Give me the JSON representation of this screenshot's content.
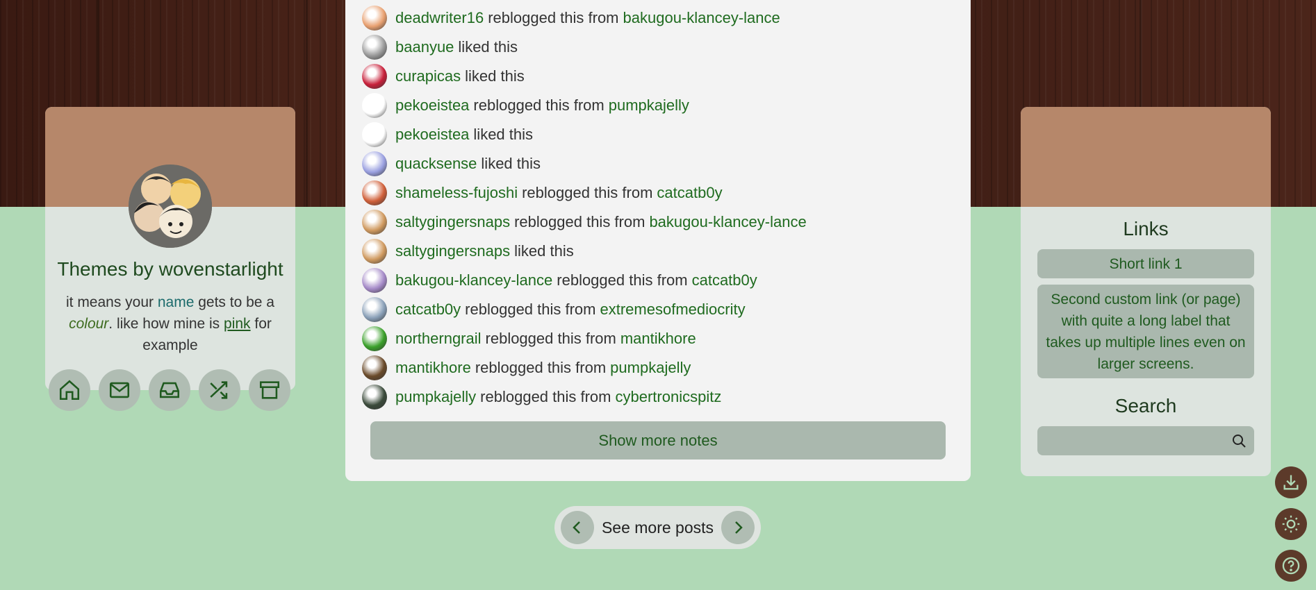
{
  "colors": {
    "accent_green": "#1f6b1f",
    "background_green": "#b0d9b6",
    "header_brown": "#b6876a",
    "wood_dark": "#3a1a12",
    "float_button": "#5c3a2a"
  },
  "sidebar_left": {
    "title": "Themes by wovenstarlight",
    "desc_1": "it means your ",
    "desc_name": "name",
    "desc_2": " gets to be a ",
    "desc_colour": "colour",
    "desc_3": ". like how mine is ",
    "desc_pink": "pink",
    "desc_4": " for example",
    "nav": [
      {
        "icon": "home-icon"
      },
      {
        "icon": "mail-icon"
      },
      {
        "icon": "inbox-icon"
      },
      {
        "icon": "shuffle-icon"
      },
      {
        "icon": "archive-icon"
      }
    ]
  },
  "notes": [
    {
      "user": "deadwriter16",
      "action": "reblogged this from",
      "from": "bakugou-klancey-lance",
      "avatar_color": "#e8a070"
    },
    {
      "user": "baanyue",
      "action": "liked this",
      "from": "",
      "avatar_color": "#9a9a9a"
    },
    {
      "user": "curapicas",
      "action": "liked this",
      "from": "",
      "avatar_color": "#c8203a"
    },
    {
      "user": "pekoeistea",
      "action": "reblogged this from",
      "from": "pumpkajelly",
      "avatar_color": "#ffffff"
    },
    {
      "user": "pekoeistea",
      "action": "liked this",
      "from": "",
      "avatar_color": "#ffffff"
    },
    {
      "user": "quacksense",
      "action": "liked this",
      "from": "",
      "avatar_color": "#9aa0e0"
    },
    {
      "user": "shameless-fujoshi",
      "action": "reblogged this from",
      "from": "catcatb0y",
      "avatar_color": "#d0603a"
    },
    {
      "user": "saltygingersnaps",
      "action": "reblogged this from",
      "from": "bakugou-klancey-lance",
      "avatar_color": "#d09a60"
    },
    {
      "user": "saltygingersnaps",
      "action": "liked this",
      "from": "",
      "avatar_color": "#d09a60"
    },
    {
      "user": "bakugou-klancey-lance",
      "action": "reblogged this from",
      "from": "catcatb0y",
      "avatar_color": "#a58ac8"
    },
    {
      "user": "catcatb0y",
      "action": "reblogged this from",
      "from": "extremesofmediocrity",
      "avatar_color": "#8aa0b8"
    },
    {
      "user": "northerngrail",
      "action": "reblogged this from",
      "from": "mantikhore",
      "avatar_color": "#3aa02a"
    },
    {
      "user": "mantikhore",
      "action": "reblogged this from",
      "from": "pumpkajelly",
      "avatar_color": "#6a4a2a"
    },
    {
      "user": "pumpkajelly",
      "action": "reblogged this from",
      "from": "cybertronicspitz",
      "avatar_color": "#3a4a3a"
    }
  ],
  "show_more_label": "Show more notes",
  "pagination": {
    "label": "See more posts",
    "prev_icon": "chevron-left-icon",
    "next_icon": "chevron-right-icon"
  },
  "sidebar_right": {
    "links_title": "Links",
    "link_1": "Short link 1",
    "link_2": "Second custom link (or page) with quite a long label that takes up multiple lines even on larger screens.",
    "search_title": "Search",
    "search_placeholder": ""
  },
  "float_buttons": [
    {
      "icon": "download-icon"
    },
    {
      "icon": "sun-icon"
    },
    {
      "icon": "help-icon"
    }
  ]
}
